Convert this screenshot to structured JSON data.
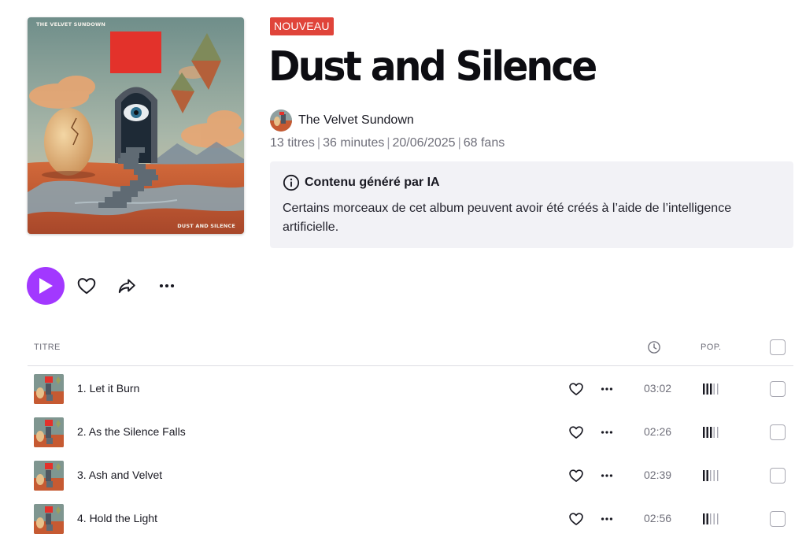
{
  "album": {
    "badge": "NOUVEAU",
    "title": "Dust and Silence",
    "artist": "The Velvet Sundown",
    "meta": {
      "tracks": "13 titres",
      "duration": "36 minutes",
      "date": "20/06/2025",
      "fans": "68 fans"
    },
    "cover_text_top": "THE VELVET SUNDOWN",
    "cover_text_bottom": "DUST AND SILENCE"
  },
  "ai_notice": {
    "title": "Contenu généré par IA",
    "text": "Certains morceaux de cet album peuvent avoir été créés à l’aide de l’intelligence artificielle."
  },
  "actions": {
    "play_icon": "play-icon",
    "favorite_icon": "heart-icon",
    "share_icon": "share-icon",
    "more_icon": "more-icon"
  },
  "table": {
    "col_title": "TITRE",
    "col_duration_icon": "clock-icon",
    "col_popularity": "POP."
  },
  "tracks": [
    {
      "title": "1. Let it Burn",
      "duration": "03:02",
      "popularity": 3
    },
    {
      "title": "2. As the Silence Falls",
      "duration": "02:26",
      "popularity": 3
    },
    {
      "title": "3. Ash and Velvet",
      "duration": "02:39",
      "popularity": 2
    },
    {
      "title": "4. Hold the Light",
      "duration": "02:56",
      "popularity": 2
    }
  ],
  "colors": {
    "accent": "#a238ff",
    "badge": "#e0443a",
    "notice_bg": "#f2f2f6"
  }
}
